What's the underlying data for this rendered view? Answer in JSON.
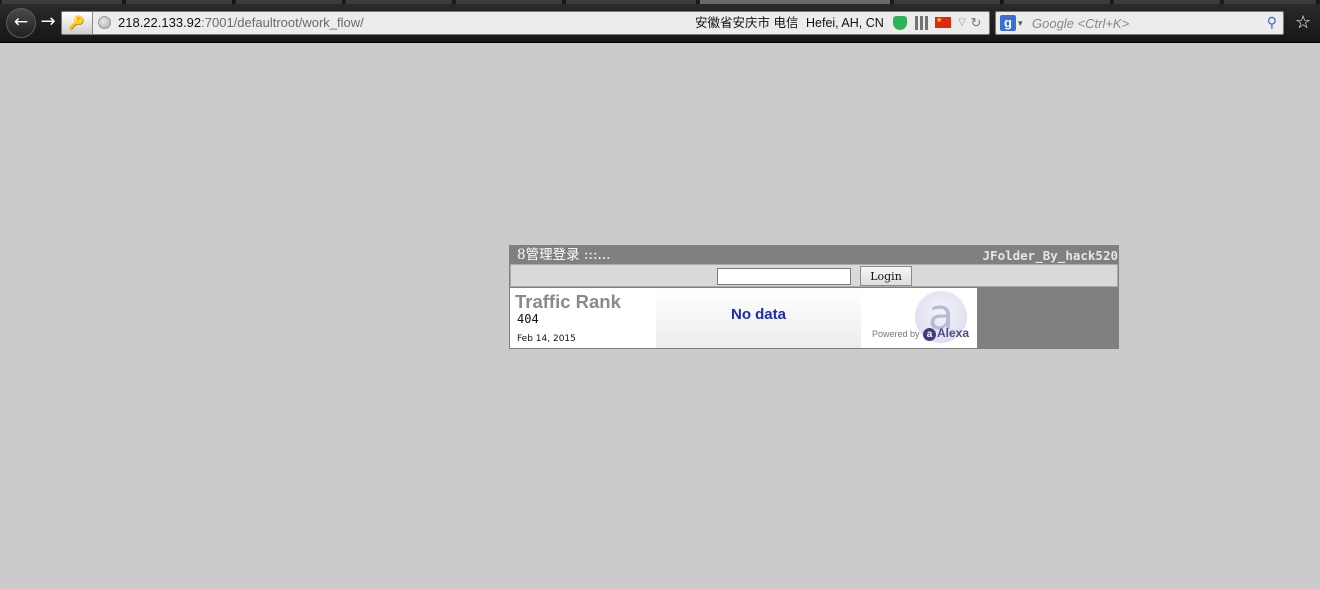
{
  "browser": {
    "url_host": "218.22.133.92",
    "url_rest": ":7001/defaultroot/work_flow/",
    "geo_location": "安徽省安庆市 电信",
    "geo_city": "Hefei, AH, CN",
    "search_placeholder": "Google <Ctrl+K>"
  },
  "panel": {
    "title": "8管理登录 :::...",
    "signature": "JFolder_By_hack520",
    "login_button": "Login",
    "password_value": ""
  },
  "alexa": {
    "label": "Traffic Rank",
    "rank": "404",
    "date": "Feb 14, 2015",
    "chart_message": "No data",
    "powered_by": "Powered by",
    "brand": "Alexa"
  },
  "colors": {
    "page_bg": "#cbcbcb",
    "panel_bg": "#808080",
    "nodata_text": "#1b2bb4"
  },
  "icons": [
    "back-icon",
    "forward-icon",
    "site-identity-icon",
    "globe-icon",
    "shield-icon",
    "qr-code-icon",
    "china-flag-icon",
    "dropdown-arrow-icon",
    "reload-icon",
    "google-icon",
    "search-icon",
    "bookmark-star-icon",
    "alexa-logo-icon"
  ]
}
